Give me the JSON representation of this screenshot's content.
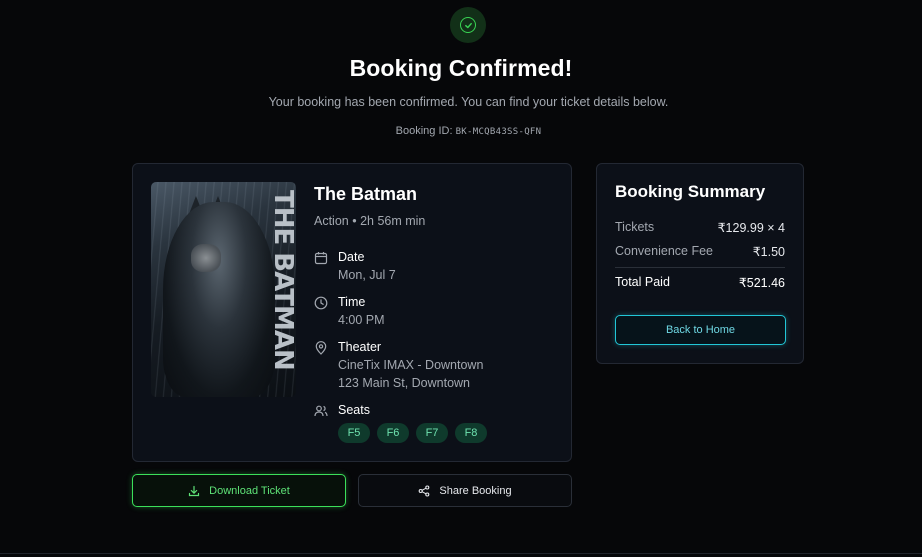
{
  "header": {
    "title": "Booking Confirmed!",
    "subtitle": "Your booking has been confirmed. You can find your ticket details below.",
    "booking_id_label": "Booking ID:",
    "booking_id": "BK-MCQB43SS-QFN"
  },
  "movie": {
    "poster_text": "THE BATMAN",
    "title": "The Batman",
    "meta": "Action • 2h 56m min",
    "date_label": "Date",
    "date_value": "Mon, Jul 7",
    "time_label": "Time",
    "time_value": "4:00 PM",
    "theater_label": "Theater",
    "theater_name": "CineTix IMAX - Downtown",
    "theater_address": "123 Main St, Downtown",
    "seats_label": "Seats",
    "seats": [
      "F5",
      "F6",
      "F7",
      "F8"
    ]
  },
  "actions": {
    "download_label": "Download Ticket",
    "share_label": "Share Booking"
  },
  "summary": {
    "title": "Booking Summary",
    "tickets_label": "Tickets",
    "tickets_value": "₹129.99 × 4",
    "fee_label": "Convenience Fee",
    "fee_value": "₹1.50",
    "total_label": "Total Paid",
    "total_value": "₹521.46",
    "back_label": "Back to Home"
  },
  "colors": {
    "accent_green": "#3be05a",
    "accent_cyan": "#22c6d6",
    "seat_bg": "#0f3a2c"
  }
}
